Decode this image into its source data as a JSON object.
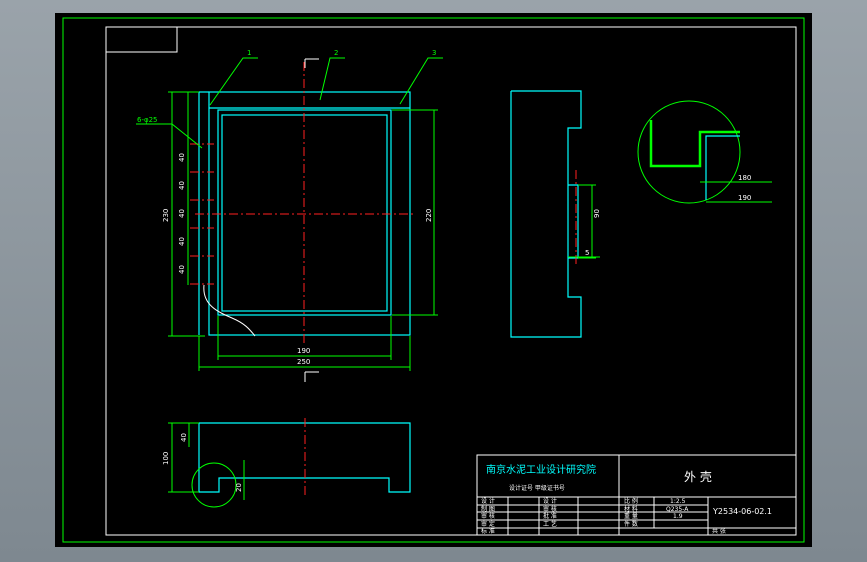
{
  "drawing": {
    "institute": "南京水泥工业设计研究院",
    "institute_sub": "设计证号  甲级证书号",
    "part_name": "外  壳",
    "drawing_no": "Y2534-06-02.1",
    "balloons": [
      "1",
      "2",
      "3"
    ],
    "hole_label": "6-φ25",
    "dims": {
      "pitch": "40",
      "height_left": "230",
      "height_right": "220",
      "inner_width": "190",
      "outer_width": "250",
      "side_slot": "90",
      "side_step": "5",
      "detail_a": "180",
      "detail_b": "190",
      "bottom_depth": "40",
      "bottom_height": "100",
      "bottom_detail": "20"
    },
    "title_block": {
      "left_labels": [
        "设  计",
        "制  图",
        "审  核",
        "审  定",
        "标  准"
      ],
      "mid_labels": [
        "设  计",
        "审  核",
        "批  准",
        "工  艺"
      ],
      "right_labels": [
        "比  例",
        "材  料",
        "重  量",
        "件  数"
      ],
      "right_values": [
        "1:2.5",
        "Q235-A",
        "1.9",
        ""
      ],
      "sheet_label": "共  张"
    }
  }
}
